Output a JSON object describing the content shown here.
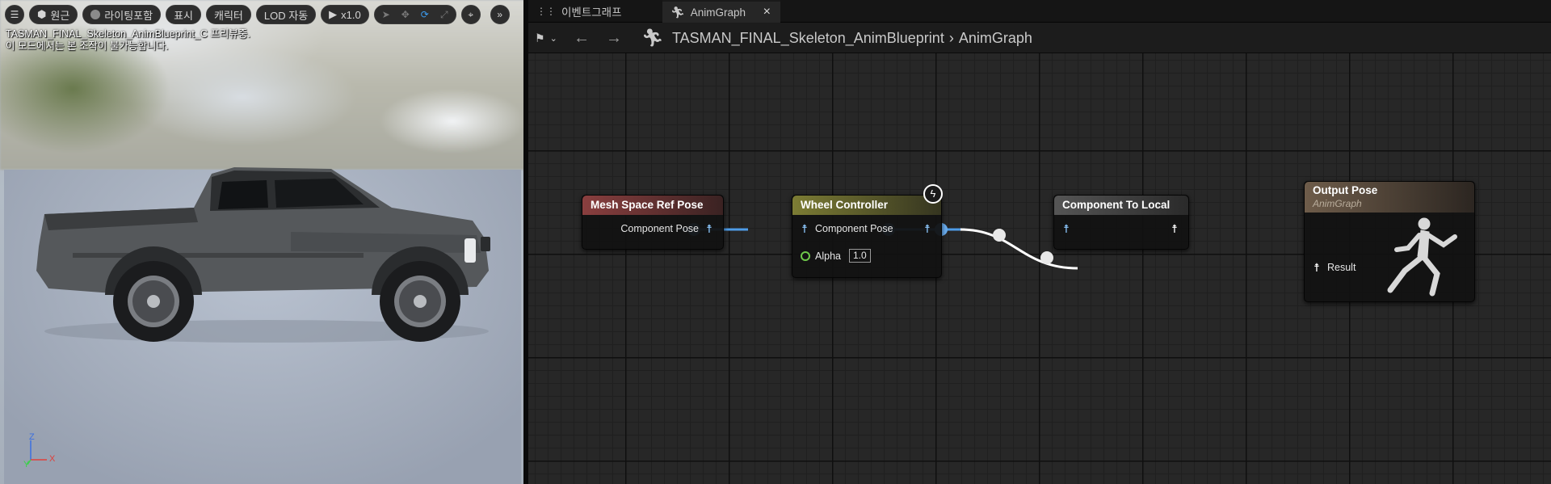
{
  "viewport": {
    "toolbar": {
      "menu_icon": "hamburger-icon",
      "perspective_label": "원근",
      "lighting_label": "라이팅포함",
      "show_label": "표시",
      "character_label": "캐릭터",
      "lod_label": "LOD 자동",
      "play_speed_label": "x1.0",
      "transform_tools": [
        "select-icon",
        "translate-icon",
        "rotate-icon",
        "scale-icon"
      ],
      "camera_icon": "camera-icon",
      "more_icon": "chevron-double-right-icon"
    },
    "info_line1": "TASMAN_FINAL_Skeleton_AnimBlueprint_C 프리뷰중.",
    "info_line2": "이 모드에서는 본 조작이 불가능합니다.",
    "axis": {
      "z": "Z",
      "y": "Y",
      "x": "X"
    }
  },
  "editor": {
    "tabs": [
      {
        "label": "이벤트그래프",
        "icon": "graph-icon"
      },
      {
        "label": "AnimGraph",
        "icon": "running-figure-icon",
        "close": "×"
      }
    ],
    "breadcrumb": {
      "blueprint": "TASMAN_FINAL_Skeleton_AnimBlueprint",
      "separator": "›",
      "graph": "AnimGraph"
    }
  },
  "graph": {
    "nodes": {
      "mesh_space_ref_pose": {
        "title": "Mesh Space Ref Pose",
        "output_label": "Component Pose"
      },
      "wheel_controller": {
        "title": "Wheel Controller",
        "pose_label": "Component Pose",
        "alpha_label": "Alpha",
        "alpha_value": "1.0"
      },
      "component_to_local": {
        "title": "Component To Local"
      },
      "output_pose": {
        "title": "Output Pose",
        "subtitle": "AnimGraph",
        "result_label": "Result"
      }
    }
  },
  "colors": {
    "mesh_space_header": "#7a3a3a",
    "wheel_controller_header": "#6f7030",
    "component_to_local_header": "#4a4a4a",
    "output_pose_header": "#6a5a48",
    "pose_wire": "#4f9de8",
    "local_wire": "#ffffff"
  }
}
